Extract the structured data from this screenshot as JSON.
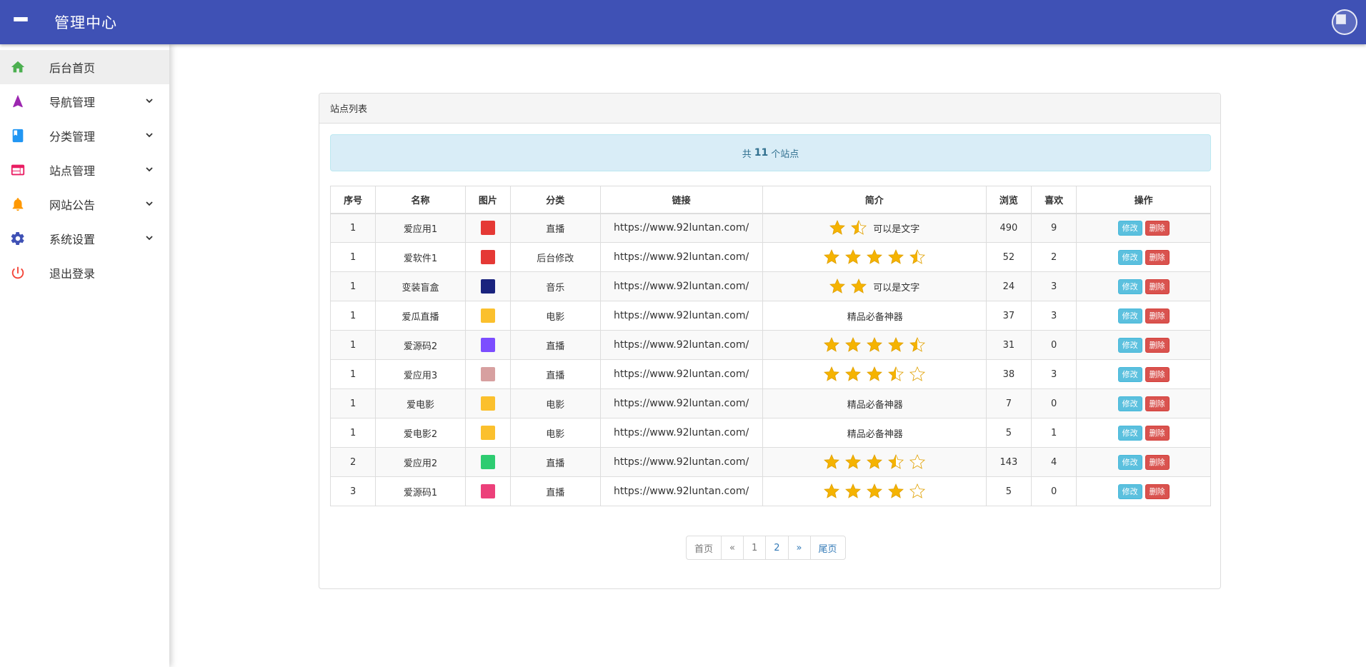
{
  "header": {
    "title": "管理中心",
    "menu_icon": "menu-icon",
    "avatar_icon": "avatar-image"
  },
  "sidebar": {
    "items": [
      {
        "label": "后台首页",
        "icon": "home-icon",
        "color": "#4caf50",
        "active": true,
        "expandable": false
      },
      {
        "label": "导航管理",
        "icon": "navigation-icon",
        "color": "#9c27b0",
        "active": false,
        "expandable": true
      },
      {
        "label": "分类管理",
        "icon": "book-icon",
        "color": "#2196f3",
        "active": false,
        "expandable": true
      },
      {
        "label": "站点管理",
        "icon": "web-icon",
        "color": "#e91e63",
        "active": false,
        "expandable": true
      },
      {
        "label": "网站公告",
        "icon": "bell-icon",
        "color": "#ff9800",
        "active": false,
        "expandable": true
      },
      {
        "label": "系统设置",
        "icon": "gear-icon",
        "color": "#3f51b5",
        "active": false,
        "expandable": true
      },
      {
        "label": "退出登录",
        "icon": "power-icon",
        "color": "#f44336",
        "active": false,
        "expandable": false
      }
    ]
  },
  "panel": {
    "title": "站点列表",
    "summary": {
      "prefix": "共",
      "count": "11",
      "suffix": "个站点"
    },
    "columns": [
      "序号",
      "名称",
      "图片",
      "分类",
      "链接",
      "简介",
      "浏览",
      "喜欢",
      "操作"
    ],
    "rows": [
      {
        "no": "1",
        "name": "爱应用1",
        "thumb_color": "#e53935",
        "category": "直播",
        "link": "https://www.92luntan.com/",
        "rating": 1.5,
        "intro": "可以是文字",
        "views": "490",
        "likes": "9"
      },
      {
        "no": "1",
        "name": "爱软件1",
        "thumb_color": "#e53935",
        "category": "后台修改",
        "link": "https://www.92luntan.com/",
        "rating": 4.5,
        "intro": "",
        "views": "52",
        "likes": "2"
      },
      {
        "no": "1",
        "name": "变装盲盒",
        "thumb_color": "#1a237e",
        "category": "音乐",
        "link": "https://www.92luntan.com/",
        "rating": 2,
        "intro": "可以是文字",
        "views": "24",
        "likes": "3"
      },
      {
        "no": "1",
        "name": "爱瓜直播",
        "thumb_color": "#fbc02d",
        "category": "电影",
        "link": "https://www.92luntan.com/",
        "rating": 0,
        "intro": "精品必备神器",
        "views": "37",
        "likes": "3"
      },
      {
        "no": "1",
        "name": "爱源码2",
        "thumb_color": "#7c4dff",
        "category": "直播",
        "link": "https://www.92luntan.com/",
        "rating": 4.5,
        "intro": "",
        "views": "31",
        "likes": "0"
      },
      {
        "no": "1",
        "name": "爱应用3",
        "thumb_color": "#d7a0a0",
        "category": "直播",
        "link": "https://www.92luntan.com/",
        "rating": 3.5,
        "intro": "",
        "views": "38",
        "likes": "3"
      },
      {
        "no": "1",
        "name": "爱电影",
        "thumb_color": "#fbc02d",
        "category": "电影",
        "link": "https://www.92luntan.com/",
        "rating": 0,
        "intro": "精品必备神器",
        "views": "7",
        "likes": "0"
      },
      {
        "no": "1",
        "name": "爱电影2",
        "thumb_color": "#fbc02d",
        "category": "电影",
        "link": "https://www.92luntan.com/",
        "rating": 0,
        "intro": "精品必备神器",
        "views": "5",
        "likes": "1"
      },
      {
        "no": "2",
        "name": "爱应用2",
        "thumb_color": "#2ecc71",
        "category": "直播",
        "link": "https://www.92luntan.com/",
        "rating": 3.5,
        "intro": "",
        "views": "143",
        "likes": "4"
      },
      {
        "no": "3",
        "name": "爱源码1",
        "thumb_color": "#ec407a",
        "category": "直播",
        "link": "https://www.92luntan.com/",
        "rating": 4,
        "intro": "",
        "views": "5",
        "likes": "0"
      }
    ],
    "actions": {
      "edit": "修改",
      "delete": "删除"
    },
    "pagination": {
      "first": "首页",
      "prev": "«",
      "pages": [
        "1",
        "2"
      ],
      "next": "»",
      "last": "尾页"
    }
  },
  "colors": {
    "primary": "#3f51b5",
    "link": "#337ab7",
    "star": "#f5b301",
    "edit": "#5bc0de",
    "delete": "#d9534f"
  }
}
